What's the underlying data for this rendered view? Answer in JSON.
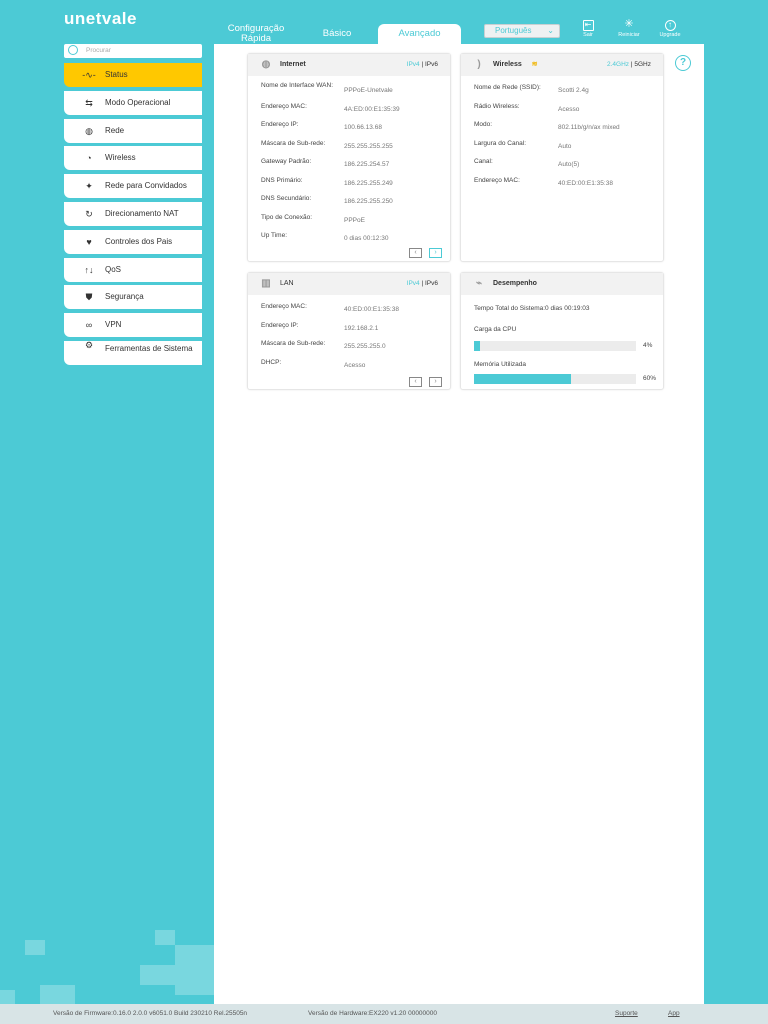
{
  "brand": "unetvale",
  "tabs": [
    {
      "label": "Configuração Rápida"
    },
    {
      "label": "Básico"
    },
    {
      "label": "Avançado"
    }
  ],
  "language": "Português",
  "tools": [
    {
      "label": "Sair",
      "icon": "logout-icon"
    },
    {
      "label": "Reiniciar",
      "icon": "reboot-icon"
    },
    {
      "label": "Upgrade",
      "icon": "upgrade-icon"
    }
  ],
  "search_placeholder": "Procurar",
  "sidebar": [
    {
      "label": "Status",
      "icon": "status-icon"
    },
    {
      "label": "Modo Operacional",
      "icon": "mode-icon"
    },
    {
      "label": "Rede",
      "icon": "network-icon"
    },
    {
      "label": "Wireless",
      "icon": "wireless-icon"
    },
    {
      "label": "Rede para Convidados",
      "icon": "guest-icon"
    },
    {
      "label": "Direcionamento NAT",
      "icon": "nat-icon"
    },
    {
      "label": "Controles dos Pais",
      "icon": "parental-icon"
    },
    {
      "label": "QoS",
      "icon": "qos-icon"
    },
    {
      "label": "Segurança",
      "icon": "shield-icon"
    },
    {
      "label": "VPN",
      "icon": "vpn-icon"
    },
    {
      "label": "Ferramentas de Sistema",
      "icon": "tools-icon"
    }
  ],
  "internet": {
    "title": "Internet",
    "ipv4": "IPv4",
    "ipv6": "IPv6",
    "rows": [
      {
        "label": "Nome de Interface WAN:",
        "value": "PPPoE-Unetvale"
      },
      {
        "label": "Endereço MAC:",
        "value": "4A:ED:00:E1:35:39"
      },
      {
        "label": "Endereço IP:",
        "value": "100.66.13.68"
      },
      {
        "label": "Máscara de Sub-rede:",
        "value": "255.255.255.255"
      },
      {
        "label": "Gateway Padrão:",
        "value": "186.225.254.57"
      },
      {
        "label": "DNS Primário:",
        "value": "186.225.255.249"
      },
      {
        "label": "DNS Secundário:",
        "value": "186.225.255.250"
      },
      {
        "label": "Tipo de Conexão:",
        "value": "PPPoE"
      },
      {
        "label": "Up Time:",
        "value": "0 dias 00:12:30"
      }
    ]
  },
  "wireless": {
    "title": "Wireless",
    "band24": "2.4GHz",
    "band5": "5GHz",
    "rows": [
      {
        "label": "Nome de Rede (SSID):",
        "value": "Scotti 2.4g"
      },
      {
        "label": "Rádio Wireless:",
        "value": "Acesso"
      },
      {
        "label": "Modo:",
        "value": "802.11b/g/n/ax mixed"
      },
      {
        "label": "Largura do Canal:",
        "value": "Auto"
      },
      {
        "label": "Canal:",
        "value": "Auto(5)"
      },
      {
        "label": "Endereço MAC:",
        "value": "40:ED:00:E1:35:38"
      }
    ]
  },
  "lan": {
    "title": "LAN",
    "ipv4": "IPv4",
    "ipv6": "IPv6",
    "rows": [
      {
        "label": "Endereço MAC:",
        "value": "40:ED:00:E1:35:38"
      },
      {
        "label": "Endereço IP:",
        "value": "192.168.2.1"
      },
      {
        "label": "Máscara de Sub-rede:",
        "value": "255.255.255.0"
      },
      {
        "label": "DHCP:",
        "value": "Acesso"
      }
    ]
  },
  "performance": {
    "title": "Desempenho",
    "uptime": "Tempo Total do Sistema:0 dias 00:19:03",
    "cpu_label": "Carga da CPU",
    "cpu_value": "4%",
    "cpu_percent": 4,
    "mem_label": "Memória Utilizada",
    "mem_value": "60%",
    "mem_percent": 60
  },
  "footer": {
    "firmware": "Versão de Firmware:0.16.0 2.0.0 v6051.0 Build 230210 Rel.25505n",
    "hardware": "Versão de Hardware:EX220 v1.20 00000000",
    "support": "Suporte",
    "app": "App"
  },
  "colors": {
    "accent": "#4ccad5",
    "active": "#ffc800"
  }
}
